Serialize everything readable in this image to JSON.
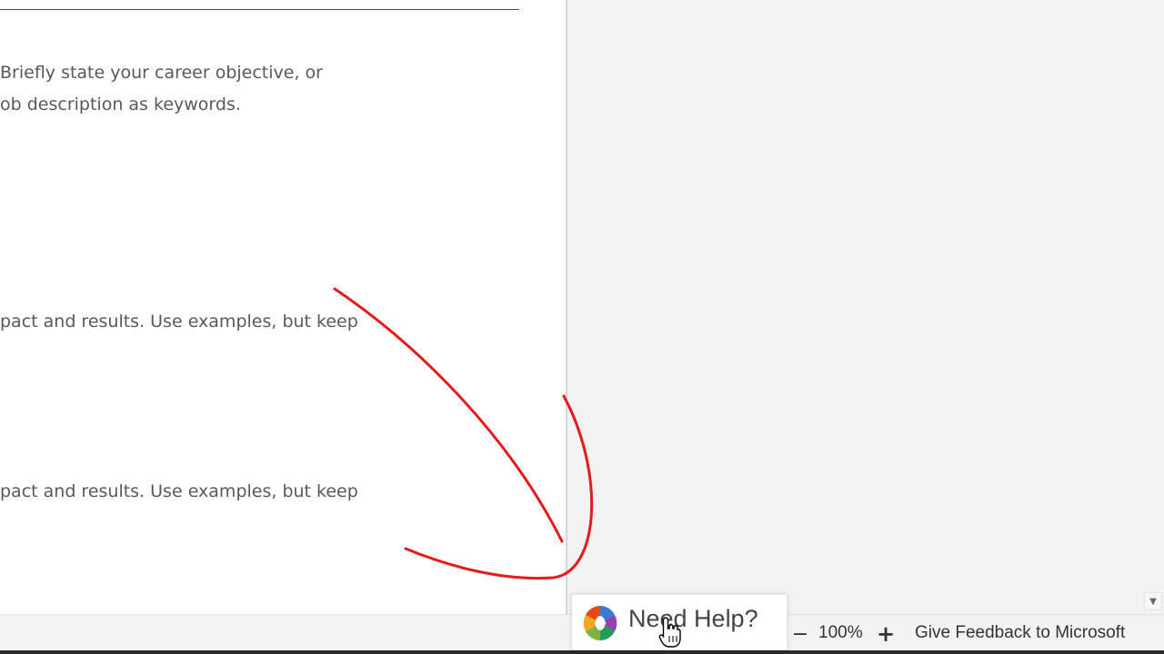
{
  "document": {
    "paragraph_1_line_1": "Briefly state your career objective, or",
    "paragraph_1_line_2": "ob description as keywords.",
    "paragraph_2": "pact and results. Use examples, but keep",
    "paragraph_3": "pact and results. Use examples, but keep"
  },
  "help": {
    "label": "Need Help?",
    "icon": "office-help-logo-icon"
  },
  "status_bar": {
    "zoom_out_icon": "minus-icon",
    "zoom_level": "100%",
    "zoom_in_icon": "plus-icon",
    "feedback": "Give Feedback to Microsoft"
  },
  "annotation": {
    "color": "#e31b1b",
    "icon": "hand-drawn-arrow"
  },
  "cursor": {
    "icon": "hand-pointer-cursor-icon"
  }
}
